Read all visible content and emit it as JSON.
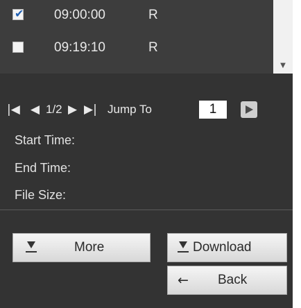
{
  "records": [
    {
      "checked": true,
      "time": "09:00:00",
      "type": "R"
    },
    {
      "checked": false,
      "time": "09:19:10",
      "type": "R"
    }
  ],
  "scrollbar": {
    "arrow_icon": "scroll-down-arrow"
  },
  "pager": {
    "first_icon": "|◀",
    "prev_icon": "◀",
    "page_text": "1/2",
    "next_icon": "▶",
    "last_icon": "▶|",
    "jump_label": "Jump To",
    "jump_value": "1",
    "go_icon": "go-arrow"
  },
  "info": {
    "start_label": "Start Time:",
    "end_label": "End Time:",
    "size_label": "File Size:"
  },
  "buttons": {
    "more_label": "More",
    "download_label": "Download",
    "back_label": "Back"
  },
  "colors": {
    "panel_bg": "#333333",
    "list_bg": "#3d3d3d",
    "text": "#e8e8e8",
    "check_color": "#1f5fb3"
  }
}
